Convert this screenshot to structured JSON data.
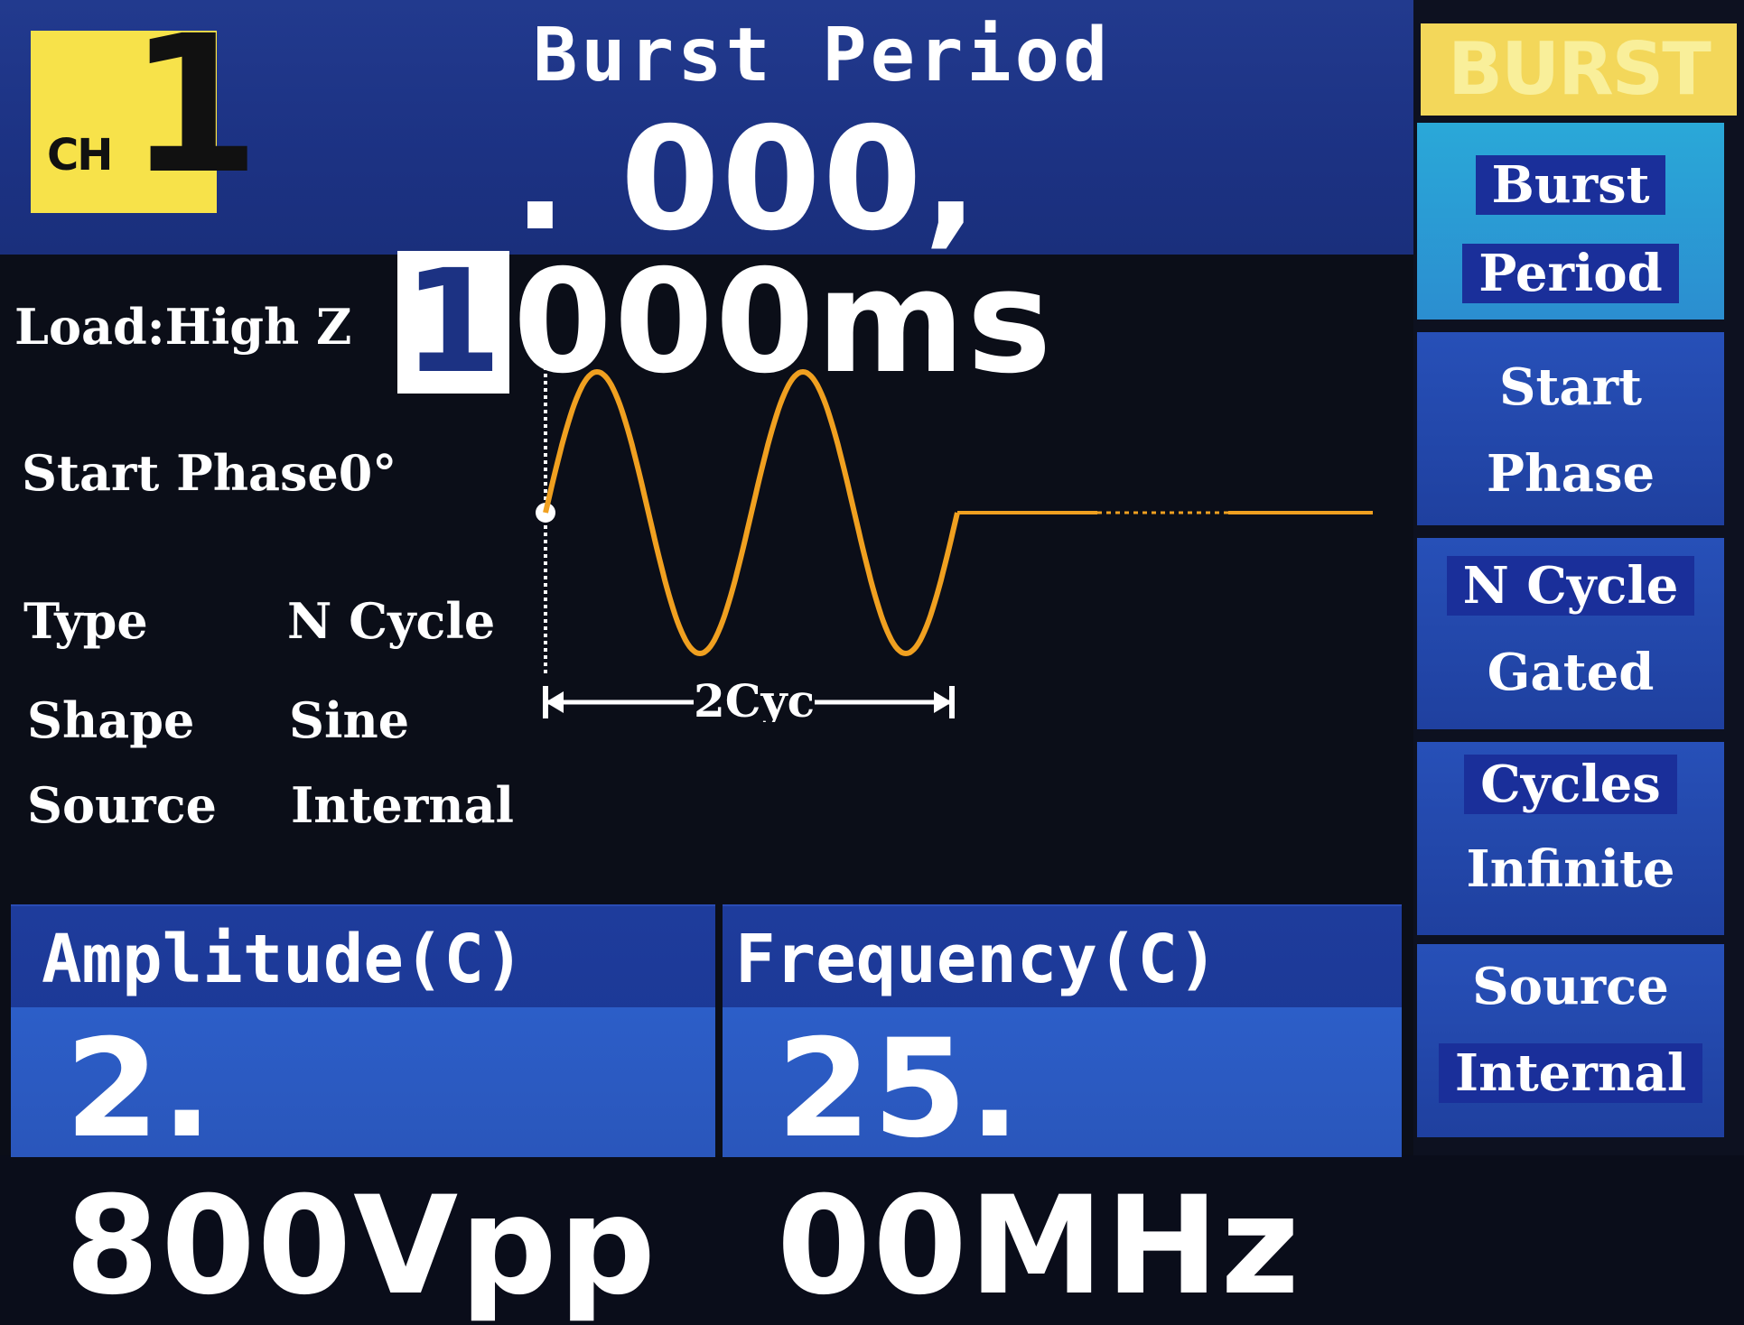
{
  "channel": {
    "label": "CH",
    "number": "1"
  },
  "header": {
    "title": "Burst Period",
    "value_cursor_digit": "1",
    "value_rest": ". 000, 000ms"
  },
  "info": {
    "load": "Load:High Z",
    "start_phase": "Start Phase0°",
    "type_label": "Type",
    "type_value": "N Cycle",
    "shape_label": "Shape",
    "shape_value": "Sine",
    "source_label": "Source",
    "source_value": "Internal"
  },
  "waveform": {
    "cycles_label": "2Cyc",
    "cycles": 2,
    "color": "#f0a020"
  },
  "bottom": {
    "amplitude_label": "Amplitude(C)",
    "amplitude_value": "2. 800Vpp",
    "frequency_label": "Frequency(C)",
    "frequency_value": "25. 00MHz"
  },
  "menu": {
    "title": "BURST",
    "items": [
      {
        "line1": "Burst",
        "line2": "Period"
      },
      {
        "line1": "Start",
        "line2": "Phase"
      },
      {
        "line1": "N Cycle",
        "line2": "Gated"
      },
      {
        "line1": "Cycles",
        "line2": "Infinite"
      },
      {
        "line1": "Source",
        "line2": "Internal"
      }
    ]
  },
  "colors": {
    "header_blue": "#1c3283",
    "accent_yellow": "#f7e24a",
    "wave_orange": "#f0a020"
  }
}
